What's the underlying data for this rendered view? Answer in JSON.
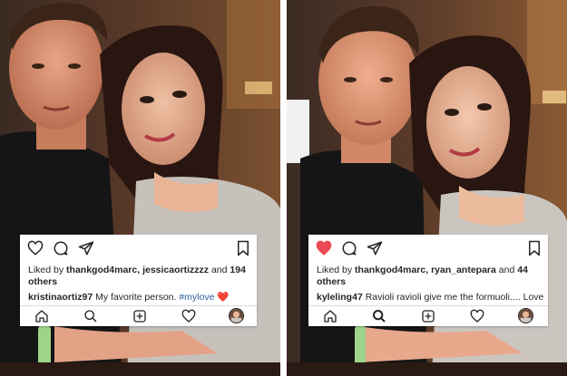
{
  "left_post": {
    "liked_prefix": "Liked by",
    "liker_1": "thankgod4marc,",
    "liker_2": "jessicaortizzzz",
    "liked_and": "and",
    "liked_count": "194 others",
    "caption_user": "kristinaortiz97",
    "caption_text": "My favorite person.",
    "caption_tag": "#mylove",
    "caption_emoji": "❤️",
    "liked": false
  },
  "right_post": {
    "liked_prefix": "Liked by",
    "liker_1": "thankgod4marc,",
    "liker_2": "ryan_antepara",
    "liked_and": "and",
    "liked_count": "44 others",
    "caption_user": "kyleling47",
    "caption_text": "Ravioli ravioli give me the formuoli.... Love",
    "liked": true
  },
  "icons": {
    "like": "heart-icon",
    "comment": "comment-icon",
    "share": "paper-plane-icon",
    "save": "bookmark-icon",
    "home": "home-icon",
    "search": "search-icon",
    "new_post": "plus-square-icon",
    "activity": "heart-outline-icon",
    "profile": "avatar"
  },
  "colors": {
    "liked_heart": "#ed4956",
    "hashtag": "#2d5d9c",
    "text": "#262626"
  }
}
